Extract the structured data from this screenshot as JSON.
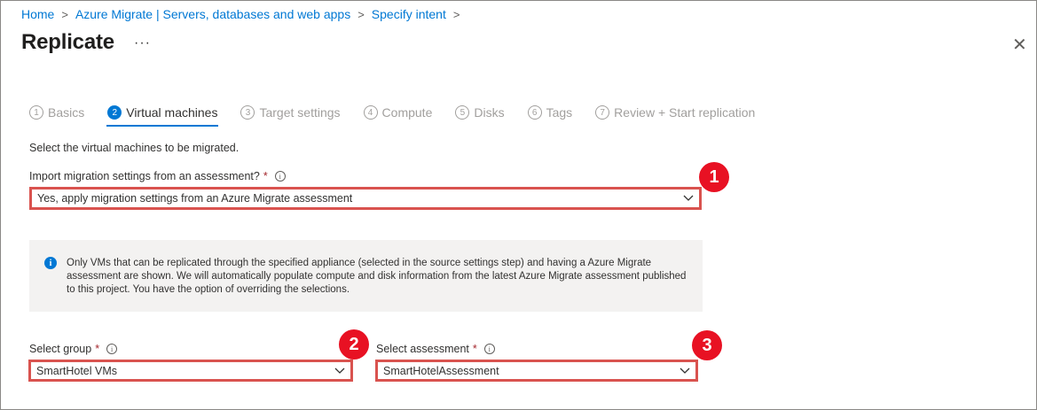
{
  "breadcrumb": {
    "items": [
      "Home",
      "Azure Migrate | Servers, databases and web apps",
      "Specify intent"
    ],
    "separator": ">"
  },
  "blade": {
    "title": "Replicate",
    "more_label": "···",
    "close_label": "✕"
  },
  "steps": [
    {
      "num": "1",
      "label": "Basics",
      "state": "complete"
    },
    {
      "num": "2",
      "label": "Virtual machines",
      "state": "active"
    },
    {
      "num": "3",
      "label": "Target settings",
      "state": "disabled"
    },
    {
      "num": "4",
      "label": "Compute",
      "state": "disabled"
    },
    {
      "num": "5",
      "label": "Disks",
      "state": "disabled"
    },
    {
      "num": "6",
      "label": "Tags",
      "state": "disabled"
    },
    {
      "num": "7",
      "label": "Review + Start replication",
      "state": "disabled"
    }
  ],
  "form": {
    "description": "Select the virtual machines to be migrated.",
    "import_label": "Import migration settings from an assessment?",
    "import_value": "Yes, apply migration settings from an Azure Migrate assessment",
    "required_mark": "*",
    "info_mark": "i",
    "info_text": "Only VMs that can be replicated through the specified appliance (selected  in the source settings step) and having a Azure Migrate assessment are shown. We will automatically populate compute and disk information from the latest Azure Migrate assessment published to this project. You have the option of overriding the selections.",
    "group_label": "Select group",
    "group_value": "SmartHotel VMs",
    "assessment_label": "Select assessment",
    "assessment_value": "SmartHotelAssessment"
  },
  "callouts": [
    "1",
    "2",
    "3"
  ],
  "colors": {
    "accent": "#0078d4",
    "highlight_border": "#d9534f",
    "callout_bg": "#e81123",
    "required": "#a4262c"
  }
}
